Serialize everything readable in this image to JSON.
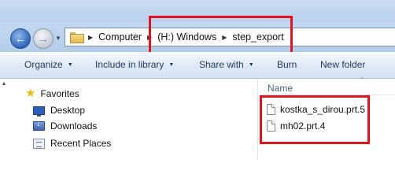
{
  "address": {
    "crumbs": [
      "Computer",
      "(H:) Windows",
      "step_export"
    ]
  },
  "toolbar": {
    "organize": "Organize",
    "include_in_library": "Include in library",
    "share_with": "Share with",
    "burn": "Burn",
    "new_folder": "New folder"
  },
  "nav": {
    "favorites": "Favorites",
    "items": [
      "Desktop",
      "Downloads",
      "Recent Places"
    ]
  },
  "files": {
    "column_name": "Name",
    "items": [
      "kostka_s_dirou.prt.5",
      "mh02.prt.4"
    ]
  },
  "colors": {
    "highlight": "#e0141e",
    "accent": "#2f67b8"
  }
}
